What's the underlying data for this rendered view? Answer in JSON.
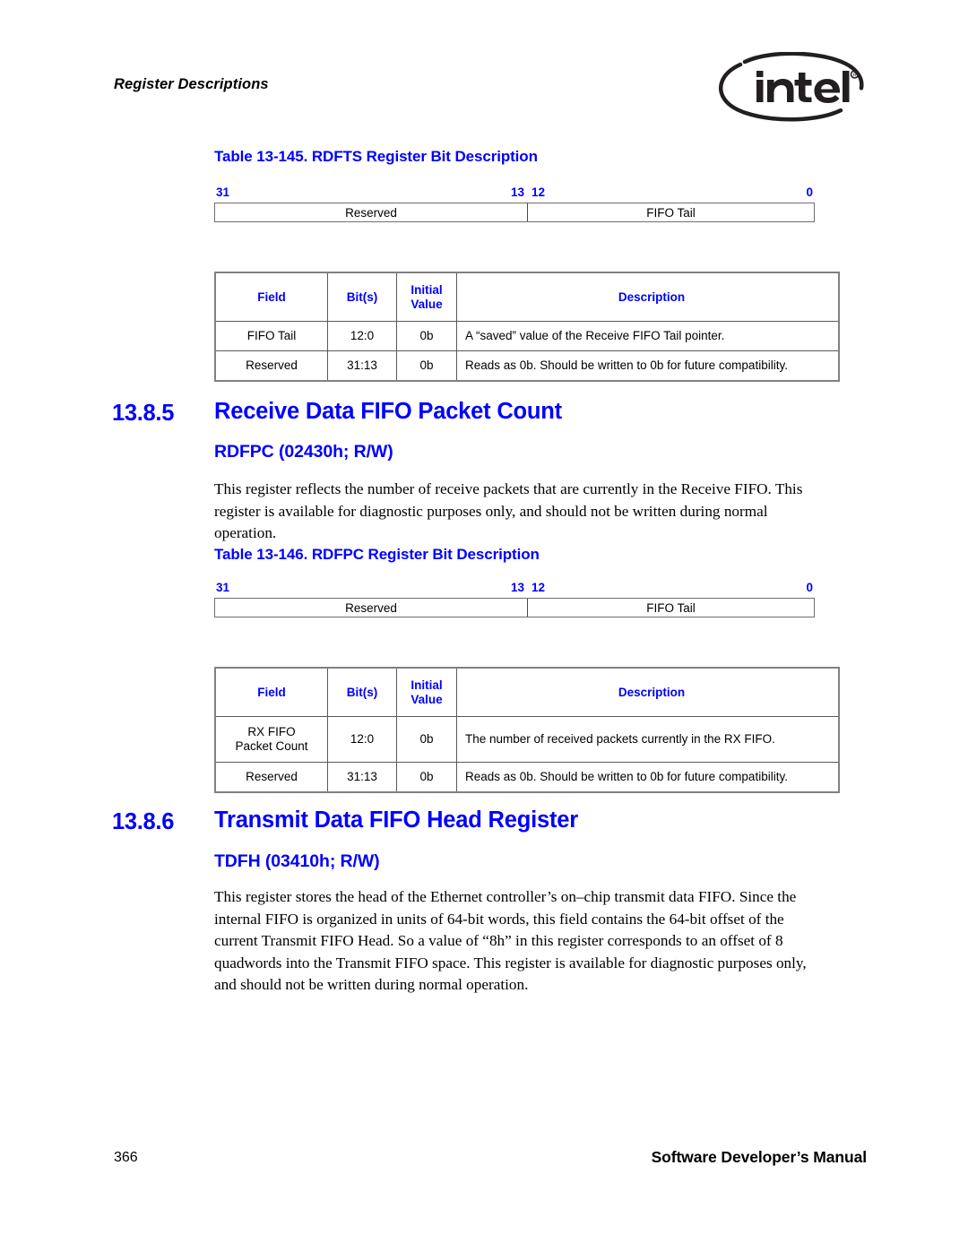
{
  "header": {
    "running_head": "Register Descriptions",
    "logo_text": "intel",
    "logo_mark": "registered-trademark"
  },
  "tables": [
    {
      "caption": "Table 13-145. RDFTS Register Bit Description",
      "bit_diagram": {
        "labels": {
          "left": "31",
          "mid_high": "13",
          "mid_low": "12",
          "right": "0"
        },
        "cells": [
          {
            "name": "Reserved"
          },
          {
            "name": "FIFO Tail"
          }
        ]
      },
      "columns": [
        "Field",
        "Bit(s)",
        "Initial Value",
        "Description"
      ],
      "column_header_lines": {
        "initial_value_line1": "Initial",
        "initial_value_line2": "Value"
      },
      "rows": [
        {
          "field": "FIFO Tail",
          "bits": "12:0",
          "initial": "0b",
          "description": "A “saved” value of the Receive FIFO Tail pointer."
        },
        {
          "field": "Reserved",
          "bits": "31:13",
          "initial": "0b",
          "description": "Reads as 0b. Should be written to 0b for future compatibility."
        }
      ]
    },
    {
      "caption": "Table 13-146. RDFPC Register Bit Description",
      "bit_diagram": {
        "labels": {
          "left": "31",
          "mid_high": "13",
          "mid_low": "12",
          "right": "0"
        },
        "cells": [
          {
            "name": "Reserved"
          },
          {
            "name": "FIFO Tail"
          }
        ]
      },
      "columns": [
        "Field",
        "Bit(s)",
        "Initial Value",
        "Description"
      ],
      "column_header_lines": {
        "initial_value_line1": "Initial",
        "initial_value_line2": "Value"
      },
      "rows": [
        {
          "field_line1": "RX FIFO",
          "field_line2": "Packet Count",
          "bits": "12:0",
          "initial": "0b",
          "description": "The number of received packets currently in the RX FIFO."
        },
        {
          "field": "Reserved",
          "bits": "31:13",
          "initial": "0b",
          "description": "Reads as 0b. Should be written to 0b for future compatibility."
        }
      ]
    }
  ],
  "sections": [
    {
      "number": "13.8.5",
      "title": "Receive Data FIFO Packet Count",
      "subtitle": "RDFPC (02430h; R/W)",
      "body": "This register reflects the number of receive packets that are currently in the Receive FIFO. This register is available for diagnostic purposes only, and should not be written during normal operation."
    },
    {
      "number": "13.8.6",
      "title": "Transmit Data FIFO Head Register",
      "subtitle": "TDFH (03410h; R/W)",
      "body": "This register stores the head of the Ethernet controller’s on–chip transmit data FIFO. Since the internal FIFO is organized in units of 64-bit words, this field contains the 64-bit offset of the current Transmit FIFO Head. So a value of “8h” in this register corresponds to an offset of 8 quadwords into the Transmit FIFO space. This register is available for diagnostic purposes only, and should not be written during normal operation."
    }
  ],
  "footer": {
    "page_number": "366",
    "manual_title": "Software Developer’s Manual"
  }
}
